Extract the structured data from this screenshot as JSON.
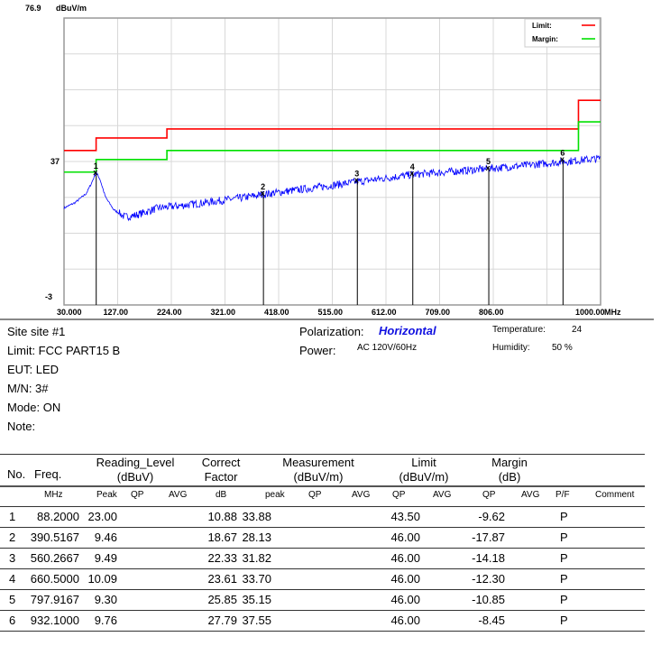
{
  "chart_data": {
    "type": "line",
    "yunit": "dBuV/m",
    "xunit": "MHz",
    "ylim": [
      -3,
      76.9
    ],
    "xlim": [
      30,
      1000
    ],
    "y_tick_labels": [
      "76.9",
      "37",
      "-3"
    ],
    "x_tick_labels": [
      "30.000",
      "127.00",
      "224.00",
      "321.00",
      "418.00",
      "515.00",
      "612.00",
      "709.00",
      "806.00",
      "1000.00"
    ],
    "grid": true,
    "legend": {
      "placement": "top-right",
      "entries": [
        {
          "label": "Limit:",
          "color": "#ff0000"
        },
        {
          "label": "Margin:",
          "color": "#00e000"
        }
      ]
    },
    "limit": [
      [
        30,
        40
      ],
      [
        88,
        40
      ],
      [
        88,
        43.5
      ],
      [
        216,
        43.5
      ],
      [
        216,
        46
      ],
      [
        960,
        46
      ],
      [
        960,
        54
      ],
      [
        1000,
        54
      ]
    ],
    "margin": [
      [
        30,
        34
      ],
      [
        88,
        34
      ],
      [
        88,
        37.5
      ],
      [
        216,
        37.5
      ],
      [
        216,
        40
      ],
      [
        960,
        40
      ],
      [
        960,
        48
      ],
      [
        1000,
        48
      ]
    ],
    "trace_color": "#0000ff",
    "trace": [
      [
        30,
        24
      ],
      [
        50,
        25.5
      ],
      [
        70,
        28
      ],
      [
        80,
        31
      ],
      [
        88,
        34
      ],
      [
        95,
        32
      ],
      [
        105,
        27
      ],
      [
        120,
        23.5
      ],
      [
        140,
        21.5
      ],
      [
        160,
        22
      ],
      [
        200,
        24
      ],
      [
        250,
        24.8
      ],
      [
        300,
        25.8
      ],
      [
        350,
        26.8
      ],
      [
        400,
        28
      ],
      [
        450,
        29
      ],
      [
        500,
        30
      ],
      [
        560,
        31.3
      ],
      [
        620,
        32.5
      ],
      [
        660,
        33.3
      ],
      [
        720,
        34
      ],
      [
        800,
        35
      ],
      [
        860,
        35.8
      ],
      [
        932,
        36.9
      ],
      [
        1000,
        37.8
      ]
    ],
    "markers": [
      {
        "label": "1",
        "freq": 88.2,
        "level": 33.88
      },
      {
        "label": "2",
        "freq": 390.5167,
        "level": 28.13
      },
      {
        "label": "3",
        "freq": 560.2667,
        "level": 31.82
      },
      {
        "label": "4",
        "freq": 660.5,
        "level": 33.7
      },
      {
        "label": "5",
        "freq": 797.9167,
        "level": 35.15
      },
      {
        "label": "6",
        "freq": 932.1,
        "level": 37.55
      }
    ]
  },
  "info": {
    "site": "Site  site #1",
    "limit": "Limit:  FCC PART15 B",
    "eut": "EUT:  LED",
    "mn": "M/N:  3#",
    "mode": "Mode:  ON",
    "note": "Note:",
    "polarization_label": "Polarization:",
    "polarization_value": "Horizontal",
    "power_label": "Power:",
    "power_value": "AC 120V/60Hz",
    "temperature_label": "Temperature:",
    "temperature_value": "24",
    "humidity_label": "Humidity:",
    "humidity_value": "50 %"
  },
  "table": {
    "headers": {
      "no": "No.",
      "freq": "Freq.",
      "reading": [
        "Reading_Level",
        "(dBuV)"
      ],
      "correct": [
        "Correct",
        "Factor"
      ],
      "measurement": [
        "Measurement",
        "(dBuV/m)"
      ],
      "limit": [
        "Limit",
        "(dBuV/m)"
      ],
      "margin": [
        "Margin",
        "(dB)"
      ]
    },
    "subheaders": [
      "MHz",
      "Peak",
      "QP",
      "AVG",
      "dB",
      "peak",
      "QP",
      "AVG",
      "QP",
      "AVG",
      "QP",
      "AVG",
      "P/F",
      "Comment"
    ],
    "rows": [
      {
        "no": "1",
        "freq": "88.2000",
        "peak": "23.00",
        "cf": "10.88",
        "meas": "33.88",
        "limit": "43.50",
        "margin": "-9.62",
        "pf": "P"
      },
      {
        "no": "2",
        "freq": "390.5167",
        "peak": "9.46",
        "cf": "18.67",
        "meas": "28.13",
        "limit": "46.00",
        "margin": "-17.87",
        "pf": "P"
      },
      {
        "no": "3",
        "freq": "560.2667",
        "peak": "9.49",
        "cf": "22.33",
        "meas": "31.82",
        "limit": "46.00",
        "margin": "-14.18",
        "pf": "P"
      },
      {
        "no": "4",
        "freq": "660.5000",
        "peak": "10.09",
        "cf": "23.61",
        "meas": "33.70",
        "limit": "46.00",
        "margin": "-12.30",
        "pf": "P"
      },
      {
        "no": "5",
        "freq": "797.9167",
        "peak": "9.30",
        "cf": "25.85",
        "meas": "35.15",
        "limit": "46.00",
        "margin": "-10.85",
        "pf": "P"
      },
      {
        "no": "6",
        "freq": "932.1000",
        "peak": "9.76",
        "cf": "27.79",
        "meas": "37.55",
        "limit": "46.00",
        "margin": "-8.45",
        "pf": "P"
      }
    ]
  }
}
